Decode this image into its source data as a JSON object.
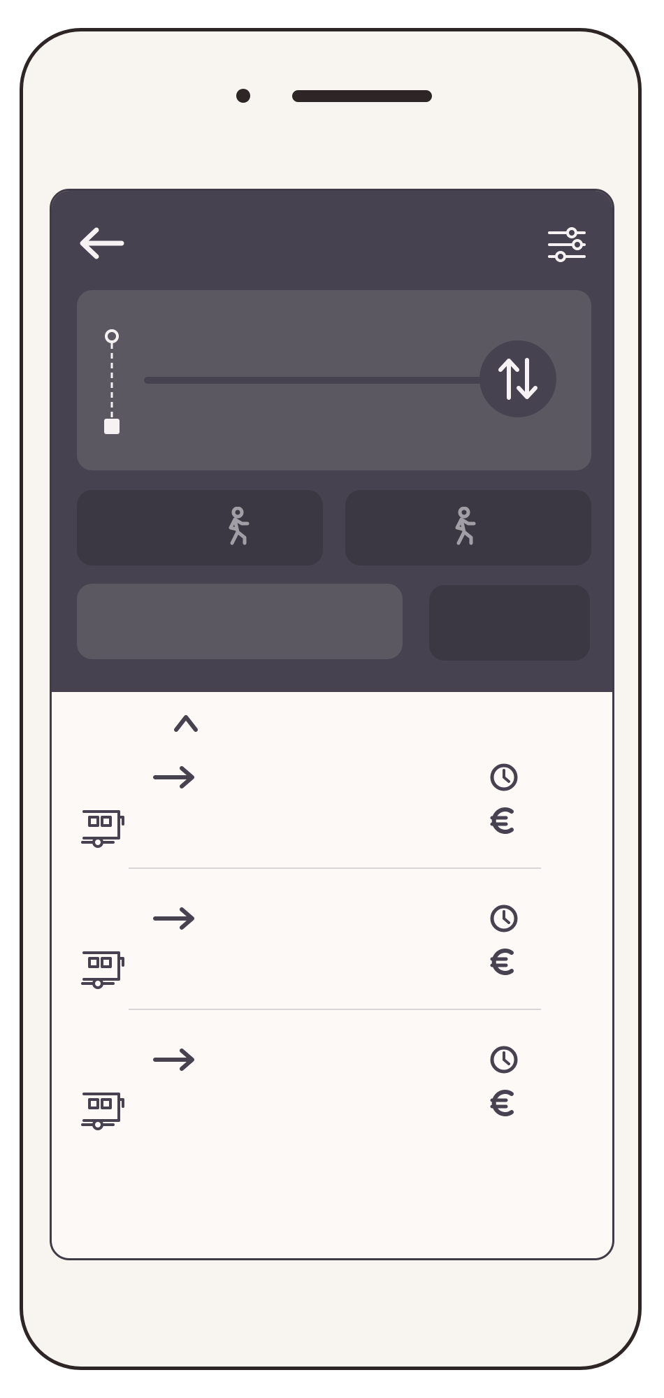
{
  "app": {
    "accent_dark": "#46424f",
    "panel_light": "#5b5862",
    "panel_darker": "#3b3844",
    "phone_frame": "#2e2626",
    "phone_body": "#f8f4f0"
  },
  "header": {
    "back_icon": "back-arrow-icon",
    "filter_icon": "sliders-icon"
  },
  "route": {
    "origin_placeholder": "",
    "destination_placeholder": "",
    "swap_icon": "swap-vertical-icon"
  },
  "options": {
    "walk_left_icon": "walking-person-icon",
    "walk_right_icon": "walking-person-icon"
  },
  "results": {
    "collapse_icon": "chevron-up-icon",
    "rows": [
      {
        "mode_icon": "train-icon",
        "arrow_icon": "arrow-right-icon",
        "duration_icon": "clock-icon",
        "price_icon": "euro-icon"
      },
      {
        "mode_icon": "train-icon",
        "arrow_icon": "arrow-right-icon",
        "duration_icon": "clock-icon",
        "price_icon": "euro-icon"
      },
      {
        "mode_icon": "train-icon",
        "arrow_icon": "arrow-right-icon",
        "duration_icon": "clock-icon",
        "price_icon": "euro-icon"
      }
    ]
  }
}
